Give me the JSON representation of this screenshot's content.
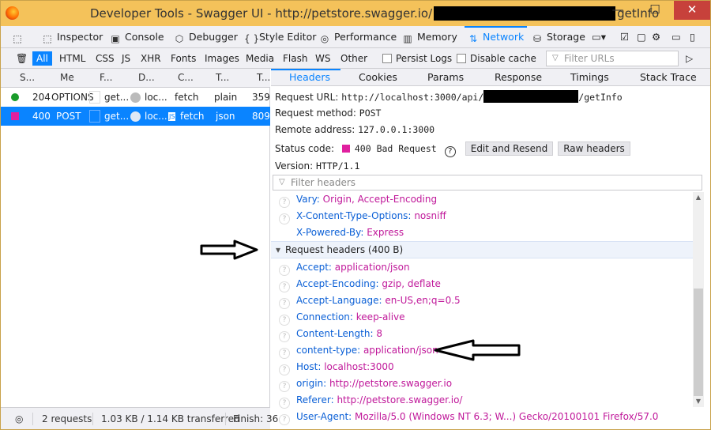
{
  "window": {
    "title_prefix": "Developer Tools - Swagger UI - http://petstore.swagger.io/",
    "title_suffix": "getInfo",
    "min_glyph": "—",
    "max_glyph": "☐",
    "close_glyph": "✕"
  },
  "toolbar": {
    "tools": [
      {
        "label": "Inspector",
        "icon": "⬚"
      },
      {
        "label": "Console",
        "icon": "▣"
      },
      {
        "label": "Debugger",
        "icon": "⬡"
      },
      {
        "label": "Style Editor",
        "icon": "{ }"
      },
      {
        "label": "Performance",
        "icon": "◎"
      },
      {
        "label": "Memory",
        "icon": "▥"
      },
      {
        "label": "Network",
        "icon": "⇅"
      },
      {
        "label": "Storage",
        "icon": "⛁"
      }
    ]
  },
  "filters": {
    "types": [
      "All",
      "HTML",
      "CSS",
      "JS",
      "XHR",
      "Fonts",
      "Images",
      "Media",
      "Flash",
      "WS",
      "Other"
    ],
    "persist_logs": "Persist Logs",
    "disable_cache": "Disable cache",
    "filter_urls_placeholder": "Filter URLs"
  },
  "requests": {
    "columns": [
      "S...",
      "Me",
      "F...",
      "D...",
      "C...",
      "T...",
      "T..."
    ],
    "rows": [
      {
        "status": "204",
        "method": "OPTIONS",
        "file": "get...",
        "domain": "loc...",
        "cause": "fetch",
        "type": "plain",
        "transferred": "359",
        "dot_color": "#1a9c2b"
      },
      {
        "status": "400",
        "method": "POST",
        "file": "get...",
        "domain": "loc...",
        "cause": "fetch",
        "cause_badge": "JS",
        "type": "json",
        "transferred": "809",
        "dot_color": "#e0209f"
      }
    ]
  },
  "status_bar": {
    "requests": "2 requests",
    "size": "1.03 KB / 1.14 KB transferred",
    "finish": "Finish: 36"
  },
  "details": {
    "tabs": [
      "Headers",
      "Cookies",
      "Params",
      "Response",
      "Timings",
      "Stack Trace"
    ],
    "request_url_label": "Request URL:",
    "request_url_prefix": "http://localhost:3000/api/",
    "request_url_suffix": "/getInfo",
    "request_method_label": "Request method:",
    "request_method": "POST",
    "remote_address_label": "Remote address:",
    "remote_address": "127.0.0.1:3000",
    "status_code_label": "Status code:",
    "status_code": "400 Bad Request",
    "edit_resend": "Edit and Resend",
    "raw_headers": "Raw headers",
    "version_label": "Version:",
    "version": "HTTP/1.1",
    "filter_headers_placeholder": "Filter headers",
    "response_headers": [
      {
        "name": "Vary:",
        "value": "Origin, Accept-Encoding"
      },
      {
        "name": "X-Content-Type-Options:",
        "value": "nosniff"
      },
      {
        "name": "X-Powered-By:",
        "value": "Express"
      }
    ],
    "request_headers_title": "Request headers (400 B)",
    "request_headers": [
      {
        "name": "Accept:",
        "value": "application/json"
      },
      {
        "name": "Accept-Encoding:",
        "value": "gzip, deflate"
      },
      {
        "name": "Accept-Language:",
        "value": "en-US,en;q=0.5"
      },
      {
        "name": "Connection:",
        "value": "keep-alive"
      },
      {
        "name": "Content-Length:",
        "value": "8"
      },
      {
        "name": "content-type:",
        "value": "application/json"
      },
      {
        "name": "Host:",
        "value": "localhost:3000"
      },
      {
        "name": "origin:",
        "value": "http://petstore.swagger.io"
      },
      {
        "name": "Referer:",
        "value": "http://petstore.swagger.io/"
      },
      {
        "name": "User-Agent:",
        "value": "Mozilla/5.0 (Windows NT 6.3; W...) Gecko/20100101 Firefox/57.0"
      }
    ]
  }
}
